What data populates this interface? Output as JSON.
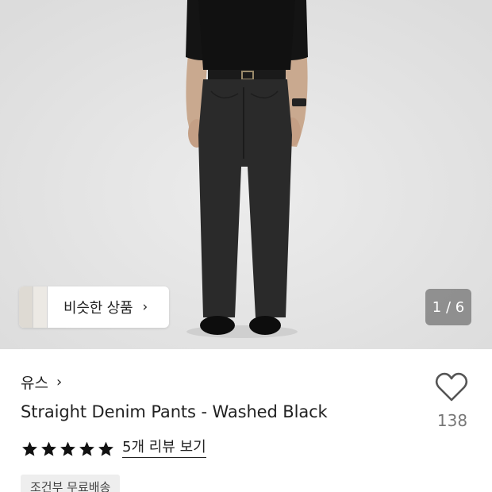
{
  "colors": {
    "hero_background": "#e4e4e4",
    "text_primary": "#222222",
    "text_muted": "#777777",
    "badge_background": "#eeeeee",
    "indicator_background": "#787878"
  },
  "gallery": {
    "similar_label": "비슷한 상품",
    "similar_chevron": "›",
    "page_indicator": "1 / 6",
    "current_page": 1,
    "total_pages": 6
  },
  "product": {
    "brand": "유스",
    "brand_chevron": "›",
    "title": "Straight Denim Pants - Washed Black",
    "rating_stars": 5,
    "review_link": "5개 리뷰 보기",
    "like_count": "138",
    "heart_icon": "heart-outline-icon",
    "star_icon": "star-filled-icon",
    "shipping_badge": "조건부 무료배송"
  }
}
